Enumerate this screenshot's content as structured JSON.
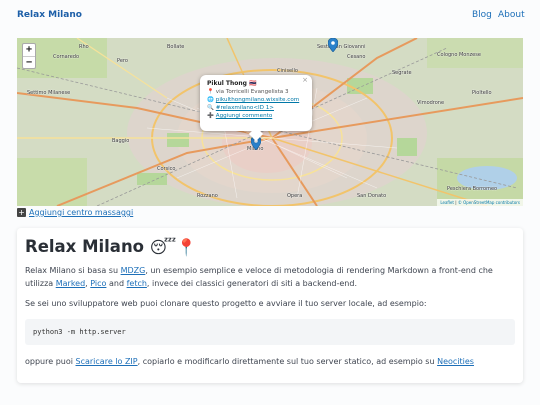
{
  "nav": {
    "brand": "Relax Milano",
    "links": [
      "Blog",
      "About"
    ]
  },
  "map": {
    "zoom_in": "+",
    "zoom_out": "−",
    "places": [
      "Cornaredo",
      "Pero",
      "Rho",
      "Bollate",
      "Settimo Milanese",
      "Milano",
      "Cesano",
      "Sesto San Giovanni",
      "Cologno Monzese",
      "Segrate",
      "Pioltello",
      "Vimodrone",
      "Peschiera Borromeo",
      "Corsico",
      "San Donato",
      "Opera",
      "Rozzano",
      "Baggio",
      "Cinisello"
    ],
    "attribution_prefix": "Leaflet",
    "attribution_link": "© OpenStreetMap contributors",
    "popup": {
      "name": "Pikul Thong 🇹🇭",
      "address": "via Torricelli Evangelista 3",
      "website": "pikulthongmilano.wixsite.com",
      "hashtag": "#relaxmilano<ID 1>",
      "comment": "Aggiungi commento",
      "close": "×",
      "pin_icon": "📍",
      "globe_icon": "🌐",
      "search_icon": "🔍",
      "plus_icon": "➕"
    }
  },
  "add_center": {
    "icon": "➕",
    "label": "Aggiungi centro massaggi"
  },
  "article": {
    "title": "Relax Milano",
    "title_emoji_1": "😴",
    "title_emoji_2": "📍",
    "p1_a": "Relax Milano si basa su ",
    "p1_link1": "MDZG",
    "p1_b": ", un esempio semplice e veloce di metodologia di rendering Markdown a front-end che utilizza ",
    "p1_link2": "Marked",
    "p1_c": ", ",
    "p1_link3": "Pico",
    "p1_d": " and ",
    "p1_link4": "fetch",
    "p1_e": ", invece dei classici generatori di siti a backend-end.",
    "p2": "Se sei uno sviluppatore web puoi clonare questo progetto e avviare il tuo server locale, ad esempio:",
    "code": "python3 -m http.server",
    "p3_a": "oppure puoi ",
    "p3_link1": "Scaricare lo ZIP",
    "p3_b": ", copiarlo e modificarlo direttamente sul tuo server statico, ad esempio su ",
    "p3_link2": "Neocities"
  }
}
